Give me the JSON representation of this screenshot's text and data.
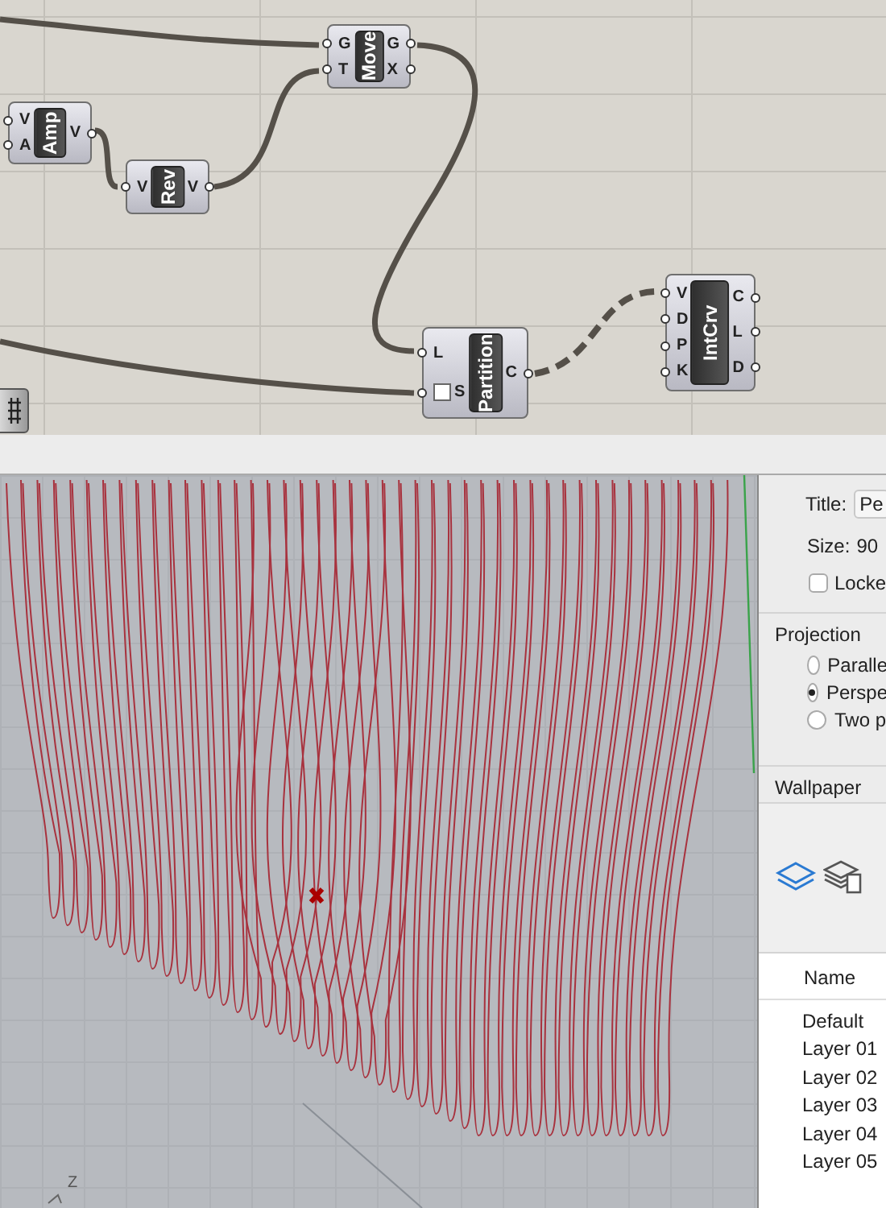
{
  "canvas": {
    "components": [
      {
        "name": "Move",
        "inputs": [
          {
            "label": "G",
            "flagged": false
          },
          {
            "label": "T",
            "flagged": false
          }
        ],
        "outputs": [
          "G",
          "X"
        ]
      },
      {
        "name": "Amp",
        "inputs": [
          {
            "label": "V",
            "flagged": false
          },
          {
            "label": "A",
            "flagged": false
          }
        ],
        "outputs": [
          "V"
        ]
      },
      {
        "name": "Rev",
        "inputs": [
          {
            "label": "V",
            "flagged": false
          }
        ],
        "outputs": [
          "V"
        ]
      },
      {
        "name": "Partition",
        "inputs": [
          {
            "label": "L",
            "flagged": false
          },
          {
            "label": "S",
            "flagged": true
          }
        ],
        "outputs": [
          "C"
        ]
      },
      {
        "name": "IntCrv",
        "inputs": [
          {
            "label": "V",
            "flagged": false
          },
          {
            "label": "D",
            "flagged": false
          },
          {
            "label": "P",
            "flagged": false
          },
          {
            "label": "K",
            "flagged": false
          }
        ],
        "outputs": [
          "C",
          "L",
          "D"
        ]
      }
    ]
  },
  "viewport": {
    "axis_label": "Z"
  },
  "panel": {
    "title_label": "Title:",
    "title_value": "Pe",
    "size_label": "Size:",
    "size_value": "90",
    "locked": {
      "label": "Locke",
      "checked": false
    },
    "projection": {
      "heading": "Projection",
      "options": [
        {
          "label": "Paralle",
          "selected": false
        },
        {
          "label": "Perspe",
          "selected": true
        },
        {
          "label": "Two p",
          "selected": false
        }
      ]
    },
    "wallpaper_heading": "Wallpaper",
    "tools": [
      {
        "kind": "layers",
        "selected": true
      },
      {
        "kind": "materials",
        "selected": false
      }
    ],
    "layers": {
      "column": "Name",
      "rows": [
        "Default",
        "Layer 01",
        "Layer 02",
        "Layer 03",
        "Layer 04",
        "Layer 05"
      ]
    }
  }
}
